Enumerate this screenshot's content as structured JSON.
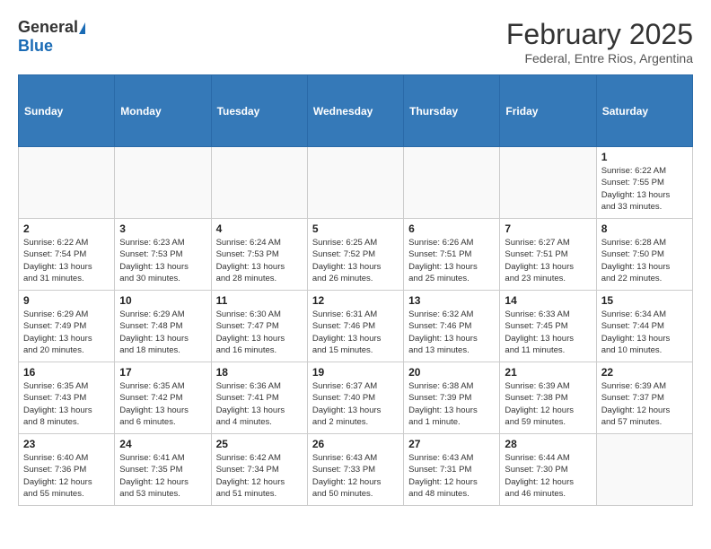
{
  "header": {
    "logo_general": "General",
    "logo_blue": "Blue",
    "month_title": "February 2025",
    "subtitle": "Federal, Entre Rios, Argentina"
  },
  "weekdays": [
    "Sunday",
    "Monday",
    "Tuesday",
    "Wednesday",
    "Thursday",
    "Friday",
    "Saturday"
  ],
  "weeks": [
    [
      {
        "day": "",
        "info": ""
      },
      {
        "day": "",
        "info": ""
      },
      {
        "day": "",
        "info": ""
      },
      {
        "day": "",
        "info": ""
      },
      {
        "day": "",
        "info": ""
      },
      {
        "day": "",
        "info": ""
      },
      {
        "day": "1",
        "info": "Sunrise: 6:22 AM\nSunset: 7:55 PM\nDaylight: 13 hours\nand 33 minutes."
      }
    ],
    [
      {
        "day": "2",
        "info": "Sunrise: 6:22 AM\nSunset: 7:54 PM\nDaylight: 13 hours\nand 31 minutes."
      },
      {
        "day": "3",
        "info": "Sunrise: 6:23 AM\nSunset: 7:53 PM\nDaylight: 13 hours\nand 30 minutes."
      },
      {
        "day": "4",
        "info": "Sunrise: 6:24 AM\nSunset: 7:53 PM\nDaylight: 13 hours\nand 28 minutes."
      },
      {
        "day": "5",
        "info": "Sunrise: 6:25 AM\nSunset: 7:52 PM\nDaylight: 13 hours\nand 26 minutes."
      },
      {
        "day": "6",
        "info": "Sunrise: 6:26 AM\nSunset: 7:51 PM\nDaylight: 13 hours\nand 25 minutes."
      },
      {
        "day": "7",
        "info": "Sunrise: 6:27 AM\nSunset: 7:51 PM\nDaylight: 13 hours\nand 23 minutes."
      },
      {
        "day": "8",
        "info": "Sunrise: 6:28 AM\nSunset: 7:50 PM\nDaylight: 13 hours\nand 22 minutes."
      }
    ],
    [
      {
        "day": "9",
        "info": "Sunrise: 6:29 AM\nSunset: 7:49 PM\nDaylight: 13 hours\nand 20 minutes."
      },
      {
        "day": "10",
        "info": "Sunrise: 6:29 AM\nSunset: 7:48 PM\nDaylight: 13 hours\nand 18 minutes."
      },
      {
        "day": "11",
        "info": "Sunrise: 6:30 AM\nSunset: 7:47 PM\nDaylight: 13 hours\nand 16 minutes."
      },
      {
        "day": "12",
        "info": "Sunrise: 6:31 AM\nSunset: 7:46 PM\nDaylight: 13 hours\nand 15 minutes."
      },
      {
        "day": "13",
        "info": "Sunrise: 6:32 AM\nSunset: 7:46 PM\nDaylight: 13 hours\nand 13 minutes."
      },
      {
        "day": "14",
        "info": "Sunrise: 6:33 AM\nSunset: 7:45 PM\nDaylight: 13 hours\nand 11 minutes."
      },
      {
        "day": "15",
        "info": "Sunrise: 6:34 AM\nSunset: 7:44 PM\nDaylight: 13 hours\nand 10 minutes."
      }
    ],
    [
      {
        "day": "16",
        "info": "Sunrise: 6:35 AM\nSunset: 7:43 PM\nDaylight: 13 hours\nand 8 minutes."
      },
      {
        "day": "17",
        "info": "Sunrise: 6:35 AM\nSunset: 7:42 PM\nDaylight: 13 hours\nand 6 minutes."
      },
      {
        "day": "18",
        "info": "Sunrise: 6:36 AM\nSunset: 7:41 PM\nDaylight: 13 hours\nand 4 minutes."
      },
      {
        "day": "19",
        "info": "Sunrise: 6:37 AM\nSunset: 7:40 PM\nDaylight: 13 hours\nand 2 minutes."
      },
      {
        "day": "20",
        "info": "Sunrise: 6:38 AM\nSunset: 7:39 PM\nDaylight: 13 hours\nand 1 minute."
      },
      {
        "day": "21",
        "info": "Sunrise: 6:39 AM\nSunset: 7:38 PM\nDaylight: 12 hours\nand 59 minutes."
      },
      {
        "day": "22",
        "info": "Sunrise: 6:39 AM\nSunset: 7:37 PM\nDaylight: 12 hours\nand 57 minutes."
      }
    ],
    [
      {
        "day": "23",
        "info": "Sunrise: 6:40 AM\nSunset: 7:36 PM\nDaylight: 12 hours\nand 55 minutes."
      },
      {
        "day": "24",
        "info": "Sunrise: 6:41 AM\nSunset: 7:35 PM\nDaylight: 12 hours\nand 53 minutes."
      },
      {
        "day": "25",
        "info": "Sunrise: 6:42 AM\nSunset: 7:34 PM\nDaylight: 12 hours\nand 51 minutes."
      },
      {
        "day": "26",
        "info": "Sunrise: 6:43 AM\nSunset: 7:33 PM\nDaylight: 12 hours\nand 50 minutes."
      },
      {
        "day": "27",
        "info": "Sunrise: 6:43 AM\nSunset: 7:31 PM\nDaylight: 12 hours\nand 48 minutes."
      },
      {
        "day": "28",
        "info": "Sunrise: 6:44 AM\nSunset: 7:30 PM\nDaylight: 12 hours\nand 46 minutes."
      },
      {
        "day": "",
        "info": ""
      }
    ]
  ]
}
